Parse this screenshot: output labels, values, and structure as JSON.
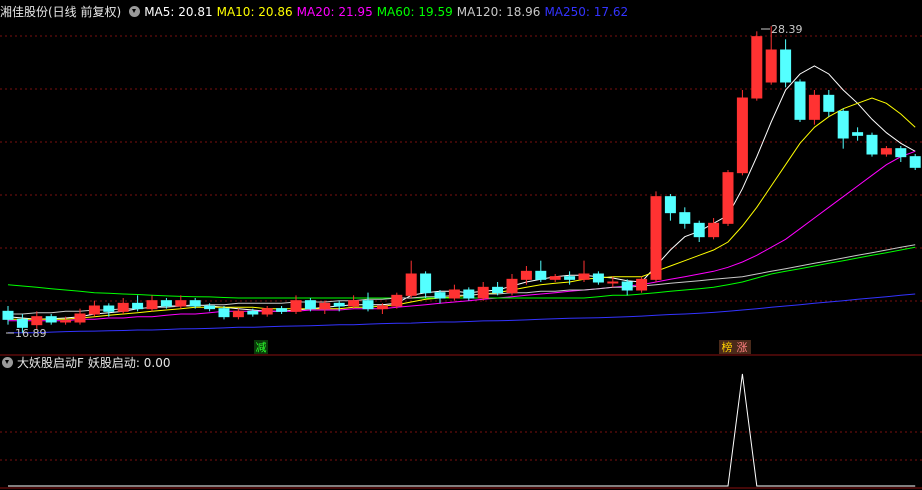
{
  "header": {
    "stock_title": "湘佳股份(日线 前复权)",
    "ma": [
      {
        "label": "MA5: 20.81",
        "color": "#ffffff"
      },
      {
        "label": "MA10: 20.86",
        "color": "#ffff00"
      },
      {
        "label": "MA20: 21.95",
        "color": "#ff00ff"
      },
      {
        "label": "MA60: 19.59",
        "color": "#00ff00"
      },
      {
        "label": "MA120: 18.96",
        "color": "#c8c8c8"
      },
      {
        "label": "MA250: 17.62",
        "color": "#3333ff"
      }
    ]
  },
  "indicator": {
    "title": "大妖股启动F",
    "value_label": "妖股启动: 0.00"
  },
  "annotations": {
    "high_label": "28.39",
    "low_label": "16.89",
    "mark_reduce": "减",
    "mark_list": "榜",
    "mark_rise": "涨"
  },
  "chart_data": {
    "type": "candlestick",
    "candles": [
      [
        17.7,
        17.4,
        17.9,
        17.2
      ],
      [
        17.4,
        17.1,
        17.6,
        16.9
      ],
      [
        17.2,
        17.5,
        17.7,
        17.0
      ],
      [
        17.5,
        17.3,
        17.6,
        17.2
      ],
      [
        17.3,
        17.35,
        17.5,
        17.2
      ],
      [
        17.3,
        17.6,
        17.8,
        17.2
      ],
      [
        17.6,
        17.9,
        18.1,
        17.5
      ],
      [
        17.9,
        17.7,
        18.0,
        17.5
      ],
      [
        17.7,
        18.0,
        18.2,
        17.6
      ],
      [
        18.0,
        17.8,
        18.3,
        17.7
      ],
      [
        17.8,
        18.1,
        18.3,
        17.7
      ],
      [
        18.1,
        17.9,
        18.2,
        17.8
      ],
      [
        17.9,
        18.1,
        18.3,
        17.8
      ],
      [
        18.1,
        17.9,
        18.2,
        17.8
      ],
      [
        17.9,
        17.8,
        18.0,
        17.7
      ],
      [
        17.8,
        17.5,
        17.9,
        17.4
      ],
      [
        17.5,
        17.7,
        17.8,
        17.4
      ],
      [
        17.7,
        17.6,
        17.8,
        17.5
      ],
      [
        17.6,
        17.8,
        17.9,
        17.5
      ],
      [
        17.8,
        17.7,
        17.9,
        17.6
      ],
      [
        17.7,
        18.1,
        18.3,
        17.6
      ],
      [
        18.1,
        17.8,
        18.2,
        17.7
      ],
      [
        17.8,
        18.0,
        18.1,
        17.6
      ],
      [
        18.0,
        17.9,
        18.1,
        17.7
      ],
      [
        17.9,
        18.1,
        18.3,
        17.8
      ],
      [
        18.1,
        17.8,
        18.4,
        17.7
      ],
      [
        17.8,
        17.9,
        18.0,
        17.6
      ],
      [
        17.9,
        18.3,
        18.4,
        17.8
      ],
      [
        18.3,
        19.1,
        19.6,
        18.2
      ],
      [
        19.1,
        18.4,
        19.2,
        18.2
      ],
      [
        18.4,
        18.2,
        18.5,
        18.0
      ],
      [
        18.2,
        18.5,
        18.7,
        18.1
      ],
      [
        18.5,
        18.2,
        18.6,
        18.1
      ],
      [
        18.2,
        18.6,
        18.8,
        18.1
      ],
      [
        18.6,
        18.4,
        18.8,
        18.3
      ],
      [
        18.4,
        18.9,
        19.1,
        18.3
      ],
      [
        18.9,
        19.2,
        19.4,
        18.7
      ],
      [
        19.2,
        18.9,
        19.6,
        18.8
      ],
      [
        18.9,
        19.0,
        19.1,
        18.8
      ],
      [
        19.0,
        18.9,
        19.2,
        18.7
      ],
      [
        18.9,
        19.1,
        19.6,
        18.8
      ],
      [
        19.1,
        18.8,
        19.2,
        18.7
      ],
      [
        18.8,
        18.8,
        19.0,
        18.6
      ],
      [
        18.8,
        18.5,
        18.9,
        18.3
      ],
      [
        18.5,
        18.9,
        19.0,
        18.4
      ],
      [
        18.9,
        22.0,
        22.2,
        18.8
      ],
      [
        22.0,
        21.4,
        22.1,
        21.1
      ],
      [
        21.4,
        21.0,
        21.6,
        20.8
      ],
      [
        21.0,
        20.5,
        21.1,
        20.3
      ],
      [
        20.5,
        21.0,
        21.2,
        20.4
      ],
      [
        21.0,
        22.9,
        23.0,
        20.9
      ],
      [
        22.9,
        25.7,
        26.0,
        22.8
      ],
      [
        25.7,
        28.0,
        28.2,
        25.6
      ],
      [
        26.3,
        27.5,
        28.39,
        26.2
      ],
      [
        27.5,
        26.3,
        27.9,
        26.1
      ],
      [
        26.3,
        24.9,
        26.4,
        24.8
      ],
      [
        24.9,
        25.8,
        26.0,
        24.7
      ],
      [
        25.8,
        25.2,
        26.0,
        25.0
      ],
      [
        25.2,
        24.2,
        25.3,
        23.8
      ],
      [
        24.4,
        24.3,
        24.6,
        24.1
      ],
      [
        24.3,
        23.6,
        24.4,
        23.5
      ],
      [
        23.6,
        23.8,
        23.9,
        23.5
      ],
      [
        23.8,
        23.5,
        23.9,
        23.3
      ],
      [
        23.5,
        23.1,
        23.6,
        23.0
      ]
    ],
    "ma_lines": [
      {
        "name": "MA5",
        "color": "#ffffff",
        "values": [
          17.5,
          17.45,
          17.4,
          17.42,
          17.45,
          17.5,
          17.6,
          17.65,
          17.7,
          17.8,
          17.85,
          17.9,
          17.9,
          17.95,
          17.9,
          17.85,
          17.8,
          17.75,
          17.7,
          17.7,
          17.75,
          17.8,
          17.85,
          17.9,
          17.95,
          17.95,
          17.95,
          18.0,
          18.3,
          18.4,
          18.45,
          18.45,
          18.4,
          18.45,
          18.5,
          18.65,
          18.8,
          18.9,
          19.0,
          19.05,
          19.05,
          19.0,
          18.95,
          18.85,
          18.8,
          19.4,
          20.0,
          20.5,
          20.7,
          21.0,
          21.3,
          22.3,
          23.5,
          24.8,
          26.0,
          26.6,
          26.9,
          26.6,
          26.0,
          25.5,
          24.9,
          24.4,
          24.0,
          23.7
        ]
      },
      {
        "name": "MA10",
        "color": "#ffff00",
        "values": [
          17.4,
          17.4,
          17.4,
          17.4,
          17.4,
          17.45,
          17.5,
          17.55,
          17.6,
          17.65,
          17.7,
          17.75,
          17.8,
          17.85,
          17.85,
          17.85,
          17.85,
          17.85,
          17.8,
          17.8,
          17.8,
          17.8,
          17.8,
          17.8,
          17.85,
          17.85,
          17.9,
          17.95,
          18.05,
          18.15,
          18.2,
          18.25,
          18.3,
          18.35,
          18.4,
          18.5,
          18.6,
          18.7,
          18.75,
          18.8,
          18.9,
          18.95,
          19.0,
          19.0,
          19.0,
          19.2,
          19.4,
          19.6,
          19.8,
          20.0,
          20.3,
          20.9,
          21.6,
          22.4,
          23.2,
          24.0,
          24.6,
          25.0,
          25.3,
          25.5,
          25.7,
          25.5,
          25.1,
          24.6
        ]
      },
      {
        "name": "MA20",
        "color": "#ff00ff",
        "values": [
          17.35,
          17.35,
          17.35,
          17.35,
          17.35,
          17.4,
          17.4,
          17.45,
          17.45,
          17.5,
          17.5,
          17.55,
          17.6,
          17.6,
          17.65,
          17.7,
          17.7,
          17.7,
          17.7,
          17.7,
          17.7,
          17.75,
          17.75,
          17.75,
          17.8,
          17.8,
          17.8,
          17.85,
          17.9,
          17.95,
          18.0,
          18.05,
          18.1,
          18.15,
          18.2,
          18.25,
          18.3,
          18.35,
          18.4,
          18.45,
          18.5,
          18.55,
          18.6,
          18.65,
          18.7,
          18.8,
          18.9,
          19.0,
          19.1,
          19.2,
          19.35,
          19.55,
          19.8,
          20.1,
          20.4,
          20.8,
          21.2,
          21.6,
          22.0,
          22.4,
          22.8,
          23.2,
          23.5,
          23.7
        ]
      },
      {
        "name": "MA60",
        "color": "#00ff00",
        "values": [
          18.7,
          18.65,
          18.6,
          18.55,
          18.5,
          18.45,
          18.4,
          18.38,
          18.35,
          18.33,
          18.3,
          18.28,
          18.26,
          18.25,
          18.24,
          18.22,
          18.2,
          18.2,
          18.2,
          18.2,
          18.2,
          18.2,
          18.2,
          18.2,
          18.2,
          18.2,
          18.2,
          18.2,
          18.2,
          18.2,
          18.2,
          18.2,
          18.2,
          18.2,
          18.2,
          18.2,
          18.2,
          18.2,
          18.2,
          18.2,
          18.2,
          18.25,
          18.3,
          18.3,
          18.35,
          18.4,
          18.45,
          18.5,
          18.55,
          18.6,
          18.7,
          18.8,
          18.95,
          19.1,
          19.2,
          19.3,
          19.4,
          19.5,
          19.6,
          19.7,
          19.8,
          19.9,
          20.0,
          20.1
        ]
      },
      {
        "name": "MA120",
        "color": "#c8c8c8",
        "values": [
          17.6,
          17.6,
          17.65,
          17.65,
          17.7,
          17.7,
          17.75,
          17.75,
          17.8,
          17.8,
          17.85,
          17.85,
          17.9,
          17.9,
          17.95,
          17.95,
          18.0,
          18.0,
          18.0,
          18.0,
          18.05,
          18.05,
          18.05,
          18.1,
          18.1,
          18.15,
          18.15,
          18.2,
          18.2,
          18.25,
          18.25,
          18.3,
          18.3,
          18.35,
          18.35,
          18.4,
          18.4,
          18.45,
          18.45,
          18.5,
          18.5,
          18.55,
          18.6,
          18.6,
          18.65,
          18.7,
          18.75,
          18.8,
          18.85,
          18.9,
          18.95,
          19.0,
          19.1,
          19.2,
          19.3,
          19.4,
          19.5,
          19.6,
          19.7,
          19.8,
          19.9,
          20.0,
          20.1,
          20.2
        ]
      },
      {
        "name": "MA250",
        "color": "#3333ff",
        "values": [
          16.9,
          16.9,
          16.9,
          16.92,
          16.94,
          16.95,
          16.96,
          16.97,
          16.98,
          17.0,
          17.0,
          17.02,
          17.04,
          17.05,
          17.06,
          17.08,
          17.1,
          17.1,
          17.12,
          17.14,
          17.15,
          17.16,
          17.18,
          17.2,
          17.2,
          17.22,
          17.24,
          17.25,
          17.26,
          17.28,
          17.3,
          17.3,
          17.32,
          17.34,
          17.35,
          17.36,
          17.38,
          17.4,
          17.42,
          17.44,
          17.45,
          17.46,
          17.48,
          17.5,
          17.52,
          17.55,
          17.58,
          17.6,
          17.63,
          17.66,
          17.7,
          17.75,
          17.8,
          17.85,
          17.9,
          17.95,
          18.0,
          18.05,
          18.1,
          18.15,
          18.2,
          18.25,
          18.3,
          18.35
        ]
      }
    ],
    "indicator": {
      "name": "妖股启动",
      "values": [
        0,
        0,
        0,
        0,
        0,
        0,
        0,
        0,
        0,
        0,
        0,
        0,
        0,
        0,
        0,
        0,
        0,
        0,
        0,
        0,
        0,
        0,
        0,
        0,
        0,
        0,
        0,
        0,
        0,
        0,
        0,
        0,
        0,
        0,
        0,
        0,
        0,
        0,
        0,
        0,
        0,
        0,
        0,
        0,
        0,
        0,
        0,
        0,
        0,
        0,
        0,
        1,
        0,
        0,
        0,
        0,
        0,
        0,
        0,
        0,
        0,
        0,
        0,
        0
      ]
    }
  }
}
